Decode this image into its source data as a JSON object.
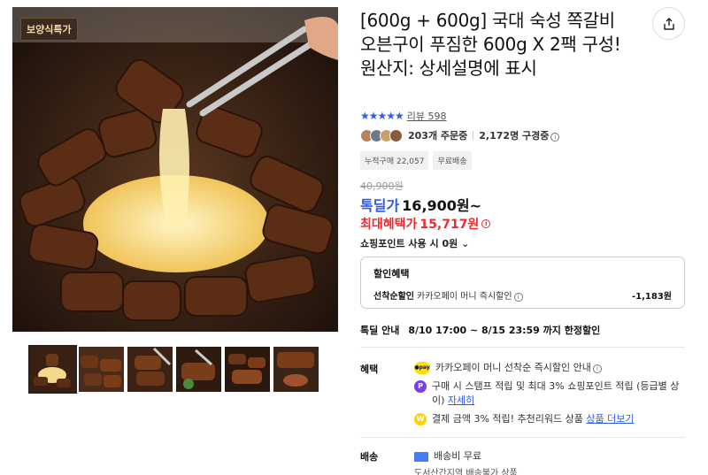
{
  "gallery": {
    "badge": "보양식특가"
  },
  "product": {
    "title": "[600g + 600g] 국대 숙성 쪽갈비 오븐구이 푸짐한 600g X 2팩 구성! 원산지: 상세설명에 표시",
    "rating_stars": "★★★★★",
    "review_label": "리뷰 598",
    "orders_text": "203개 주문중",
    "subscribers_text": "2,172명 구경중",
    "chips": [
      "누적구매 22,057",
      "무료배송"
    ]
  },
  "price": {
    "original": "40,900원",
    "deal_label": "톡딜가",
    "deal_value": "16,900원~",
    "max_label": "최대혜택가",
    "max_value": "15,717원",
    "points_label": "쇼핑포인트 사용 시",
    "points_value": "0원"
  },
  "benefit_box": {
    "title": "할인혜택",
    "row_label_bold": "선착순할인",
    "row_label": "카카오페이 머니 즉시할인",
    "row_value": "-1,183원"
  },
  "notice": {
    "label": "톡딜 안내",
    "text": "8/10 17:00 ~ 8/15 23:59 까지 한정할인"
  },
  "benefits": {
    "label": "혜택",
    "items": [
      {
        "icon": "pay",
        "icon_text": "●pay",
        "text": "카카오페이 머니 선착순 즉시할인 안내"
      },
      {
        "icon": "P",
        "icon_text": "P",
        "text": "구매 시 스탬프 적립 및 최대 3% 쇼핑포인트 적립 (등급별 상이)",
        "link": "자세히"
      },
      {
        "icon": "W",
        "icon_text": "W",
        "text": "결제 금액 3% 적립! 추천리워드 상품",
        "link": "상품 더보기"
      }
    ]
  },
  "shipping": {
    "label": "배송",
    "fee": "배송비 무료",
    "sub": "도서산간지역 배송불가 상품"
  },
  "colors": {
    "accent_blue": "#2f5bea",
    "accent_red": "#f0282c"
  }
}
